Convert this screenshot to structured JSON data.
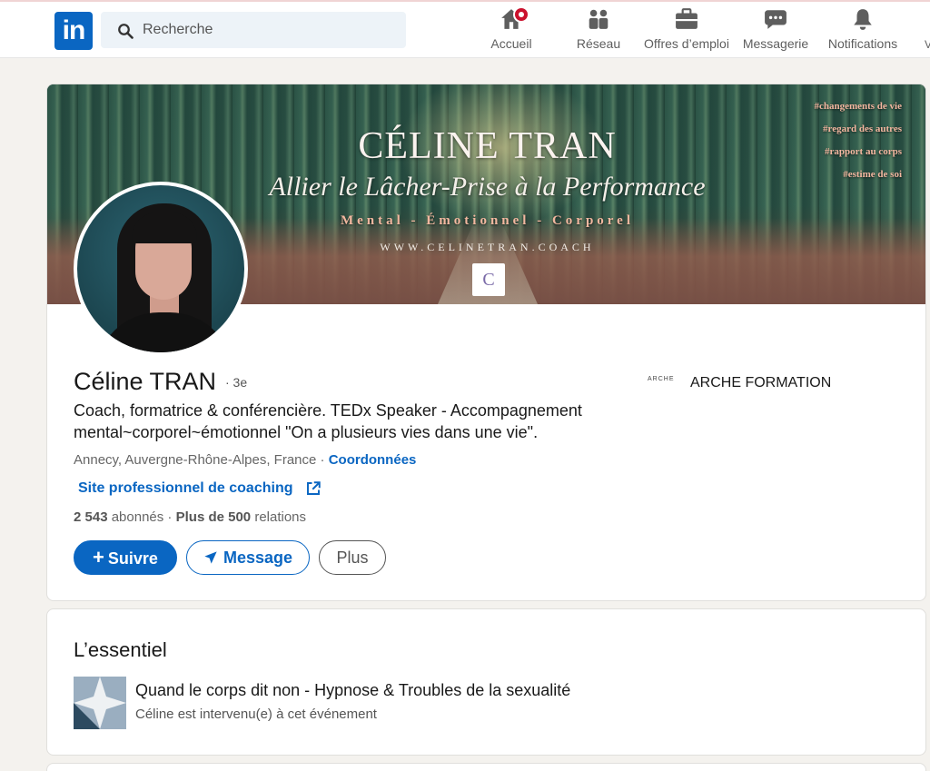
{
  "nav": {
    "logo_text": "in",
    "search_placeholder": "Recherche",
    "items": [
      {
        "label": "Accueil",
        "icon": "home-icon"
      },
      {
        "label": "Réseau",
        "icon": "network-icon"
      },
      {
        "label": "Offres d’emploi",
        "icon": "briefcase-icon"
      },
      {
        "label": "Messagerie",
        "icon": "chat-icon"
      },
      {
        "label": "Notifications",
        "icon": "bell-icon"
      }
    ],
    "edge_glyph": "V"
  },
  "banner": {
    "title": "CÉLINE TRAN",
    "tagline": "Allier le Lâcher-Prise à la Performance",
    "subtitle": "Mental - Émotionnel - Corporel",
    "url": "WWW.CELINETRAN.COACH",
    "monogram": "C",
    "hashtags": [
      "#changements de vie",
      "#regard des autres",
      "#rapport au corps",
      "#estime de soi"
    ]
  },
  "profile": {
    "name": "Céline TRAN",
    "degree": "· 3e",
    "headline": "Coach, formatrice & conférencière. TEDx Speaker - Accompagnement mental~corporel~émotionnel \"On a plusieurs vies dans une vie\".",
    "location": "Annecy, Auvergne-Rhône-Alpes, France · ",
    "contact_link": "Coordonnées",
    "website_label": "Site professionnel de coaching",
    "followers_count": "2 543",
    "followers_label": " abonnés · ",
    "connections_count": "Plus de 500",
    "connections_label": " relations",
    "company_logo_text": "ARCHE",
    "company_name": "ARCHE FORMATION"
  },
  "actions": {
    "follow": "Suivre",
    "message": "Message",
    "more": "Plus"
  },
  "colors": {
    "brand": "#0a66c2",
    "background": "#f4f2ee"
  },
  "essentials": {
    "title": "L’essentiel",
    "event_title": "Quand le corps dit non - Hypnose & Troubles de la sexualité",
    "event_subtitle": "Céline est intervenu(e) à cet événement"
  }
}
